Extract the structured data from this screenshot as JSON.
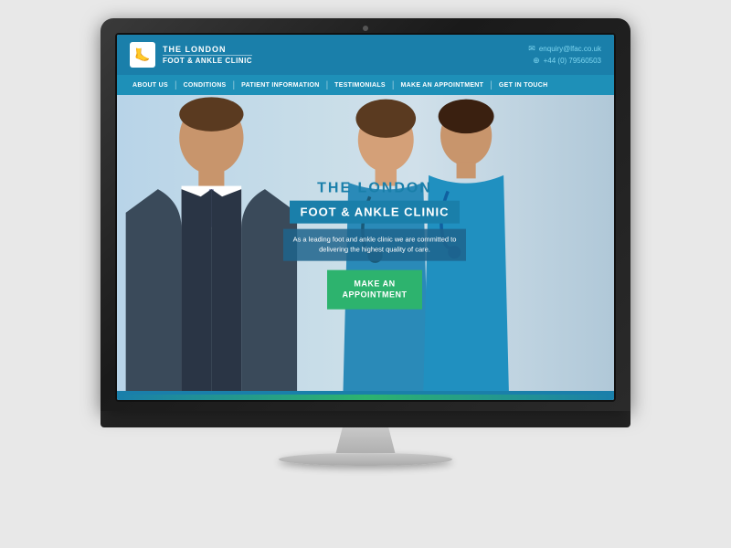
{
  "monitor": {
    "apple_symbol": ""
  },
  "website": {
    "header": {
      "logo": {
        "icon": "🦶",
        "title_line1": "THE LONDON",
        "title_line2": "FOOT & ANKLE CLINIC"
      },
      "contact": {
        "email_icon": "✉",
        "email": "enquiry@lfac.co.uk",
        "phone_icon": "⊕",
        "phone": "+44 (0) 79560503"
      }
    },
    "nav": {
      "items": [
        "ABOUT US",
        "CONDITIONS",
        "PATIENT INFORMATION",
        "TESTIMONIALS",
        "MAKE AN APPOINTMENT",
        "GET IN TOUCH"
      ]
    },
    "hero": {
      "title_top": "THE LONDON",
      "title_main": "FOOT & ANKLE CLINIC",
      "description": "As a leading foot and ankle clinic we are committed to delivering the highest quality of care.",
      "cta_line1": "MAKE AN",
      "cta_line2": "APPOINTMENT"
    }
  }
}
